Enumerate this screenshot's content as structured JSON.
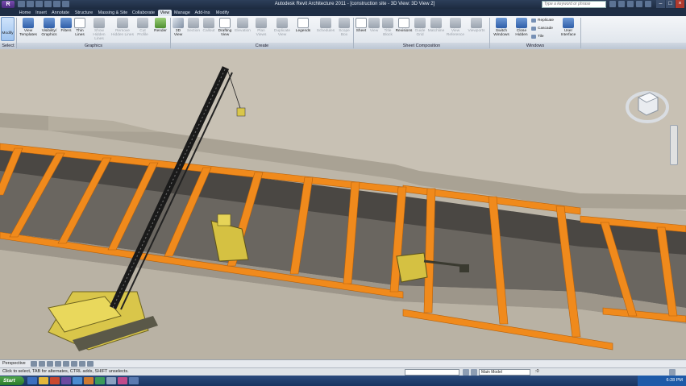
{
  "titlebar": {
    "app_button": "R",
    "title": "Autodesk Revit Architecture 2011 - [construction site - 3D View: 3D View 2]",
    "search_placeholder": "Type a keyword or phrase"
  },
  "tabs": [
    "Home",
    "Insert",
    "Annotate",
    "Structure",
    "Massing & Site",
    "Collaborate",
    "View",
    "Manage",
    "Add-Ins",
    "Modify"
  ],
  "active_tab": "View",
  "ribbon": {
    "select_label": "Modify",
    "select_panel": "Select",
    "graphics_buttons": [
      {
        "label": "View Templates",
        "dim": false
      },
      {
        "label": "Visibility/ Graphics",
        "dim": false
      },
      {
        "label": "Filters",
        "dim": false
      },
      {
        "label": "Thin Lines",
        "dim": false
      },
      {
        "label": "Show Hidden Lines",
        "dim": true
      },
      {
        "label": "Remove Hidden Lines",
        "dim": true
      },
      {
        "label": "Cut Profile",
        "dim": true
      },
      {
        "label": "Render",
        "dim": false
      }
    ],
    "graphics_panel": "Graphics",
    "create_buttons": [
      {
        "label": "3D View",
        "dim": false
      },
      {
        "label": "Section",
        "dim": true
      },
      {
        "label": "Callout",
        "dim": true
      },
      {
        "label": "Drafting View",
        "dim": false
      },
      {
        "label": "Elevation",
        "dim": true
      },
      {
        "label": "Plan Views",
        "dim": true
      },
      {
        "label": "Duplicate View",
        "dim": true
      },
      {
        "label": "Legends",
        "dim": false
      },
      {
        "label": "Schedules",
        "dim": true
      },
      {
        "label": "Scope Box",
        "dim": true
      }
    ],
    "create_panel": "Create",
    "sheet_buttons": [
      {
        "label": "Sheet",
        "dim": false
      },
      {
        "label": "View",
        "dim": true
      },
      {
        "label": "Title Block",
        "dim": true
      },
      {
        "label": "Revisions",
        "dim": false
      },
      {
        "label": "Guide Grid",
        "dim": true
      },
      {
        "label": "Matchline",
        "dim": true
      },
      {
        "label": "View Reference",
        "dim": true
      },
      {
        "label": "Viewports",
        "dim": true
      }
    ],
    "sheet_panel": "Sheet Composition",
    "window_buttons": [
      {
        "label": "Switch Windows",
        "dim": false
      },
      {
        "label": "Close Hidden",
        "dim": false
      }
    ],
    "window_small": [
      "Replicate",
      "Cascade",
      "Tile"
    ],
    "user_interface": "User Interface",
    "window_panel": "Windows"
  },
  "view_control": {
    "mode": "Perspective"
  },
  "status": {
    "message": "Click to select, TAB for alternates, CTRL adds, SHIFT unselects.",
    "workset": "Main Model",
    "zoom": ":0"
  },
  "taskbar": {
    "start": "Start",
    "clock": "6:28 PM"
  }
}
